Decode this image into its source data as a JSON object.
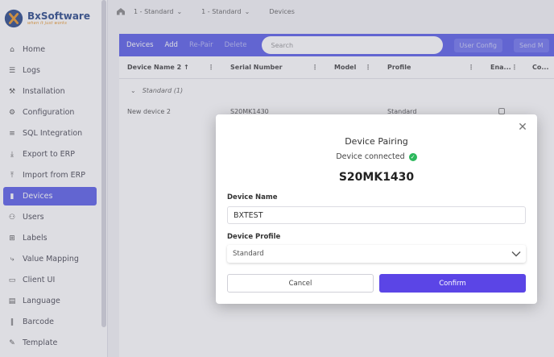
{
  "brand": {
    "name": "BxSoftware",
    "tagline": "when it just works"
  },
  "colors": {
    "accent": "#5b5fe8",
    "confirm": "#5b45e6",
    "success": "#2cb85c"
  },
  "sidebar": {
    "items": [
      {
        "label": "Home",
        "icon": "home-icon"
      },
      {
        "label": "Logs",
        "icon": "list-icon"
      },
      {
        "label": "Installation",
        "icon": "wrench-icon"
      },
      {
        "label": "Configuration",
        "icon": "gear-icon"
      },
      {
        "label": "SQL Integration",
        "icon": "database-icon"
      },
      {
        "label": "Export to ERP",
        "icon": "download-icon"
      },
      {
        "label": "Import from ERP",
        "icon": "upload-icon"
      },
      {
        "label": "Devices",
        "icon": "device-icon",
        "active": true
      },
      {
        "label": "Users",
        "icon": "users-icon"
      },
      {
        "label": "Labels",
        "icon": "label-icon"
      },
      {
        "label": "Value Mapping",
        "icon": "mapping-icon"
      },
      {
        "label": "Client UI",
        "icon": "monitor-icon"
      },
      {
        "label": "Language",
        "icon": "keyboard-icon"
      },
      {
        "label": "Barcode",
        "icon": "barcode-icon"
      },
      {
        "label": "Template",
        "icon": "template-icon"
      }
    ]
  },
  "breadcrumb": {
    "items": [
      "1 - Standard",
      "1 - Standard",
      "Devices"
    ]
  },
  "toolbar": {
    "devices_label": "Devices",
    "add_label": "Add",
    "repair_label": "Re-Pair",
    "delete_label": "Delete",
    "search_placeholder": "Search",
    "user_config_label": "User Config",
    "send_label": "Send M"
  },
  "table": {
    "columns": {
      "device_name": "Device Name",
      "sort_index": "2",
      "serial": "Serial Number",
      "model": "Model",
      "profile": "Profile",
      "enabled": "Ena...",
      "more": "Co..."
    },
    "group_label": "Standard (1)",
    "rows": [
      {
        "name": "New device 2",
        "serial": "S20MK1430",
        "model": "",
        "profile": "Standard"
      }
    ]
  },
  "modal": {
    "title": "Device Pairing",
    "status": "Device connected",
    "serial": "S20MK1430",
    "name_label": "Device Name",
    "name_value": "BXTEST",
    "profile_label": "Device Profile",
    "profile_value": "Standard",
    "cancel_label": "Cancel",
    "confirm_label": "Confirm"
  }
}
